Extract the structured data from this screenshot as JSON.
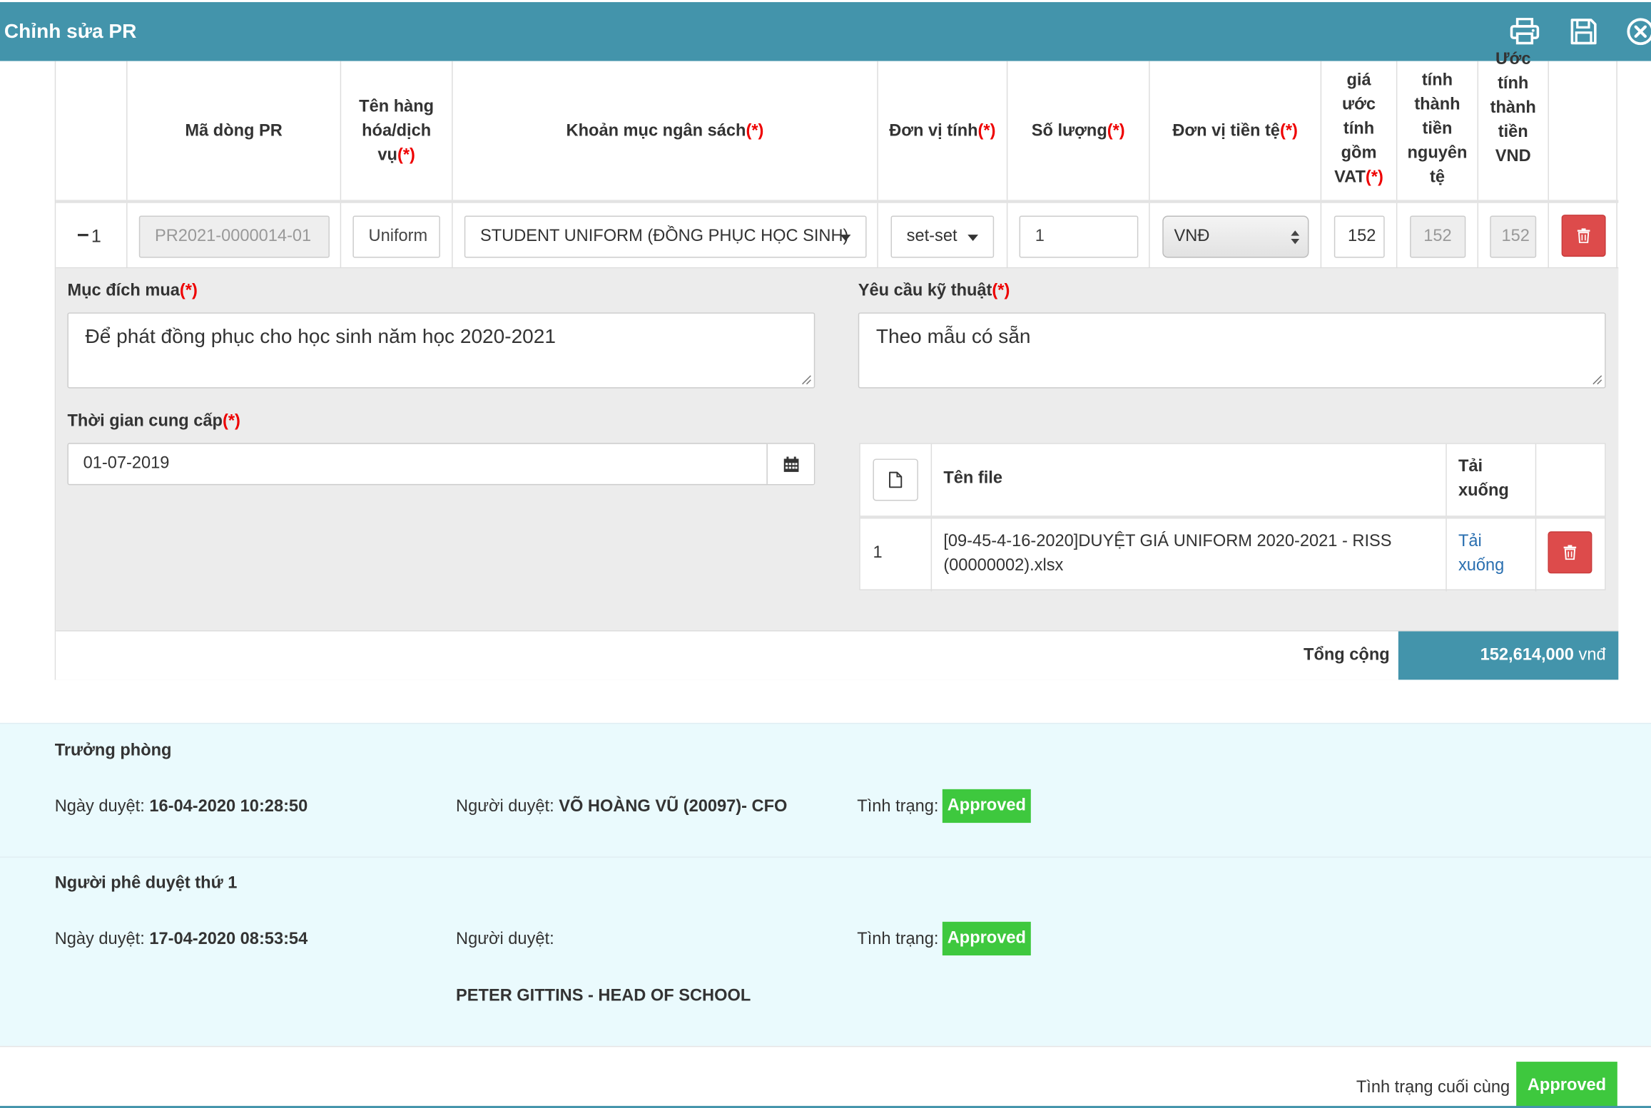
{
  "window": {
    "title": "Chỉnh sửa PR"
  },
  "icons": {
    "print": "print-icon",
    "save": "save-icon",
    "close": "close-circle-icon"
  },
  "columns": {
    "line_code": "Mã dòng PR",
    "item_name": "Tên hàng hóa/dịch vụ",
    "budget": "Khoản mục ngân sách",
    "unit": "Đơn vị tính",
    "quantity": "Số lượng",
    "currency": "Đơn vị tiền tệ",
    "est_price_vat": "giá ước tính gồm VAT",
    "est_total_orig": "tính thành tiền nguyên tệ",
    "est_total_vnd": "Ước tính thành tiền VND",
    "required_mark": "(*)"
  },
  "row": {
    "toggle": "−",
    "index": "1",
    "line_code": "PR2021-0000014-01",
    "item_name": "Uniform",
    "budget": "STUDENT UNIFORM (ĐỒNG PHỤC HỌC SINH)",
    "unit": "set-set",
    "quantity": "1",
    "currency": "VNĐ",
    "est_price_vat": "152",
    "est_total_orig": "152",
    "est_total_vnd": "152"
  },
  "detail": {
    "purpose_label": "Mục đích mua",
    "purpose_value": "Để phát đồng phục cho học sinh năm học 2020-2021",
    "tech_label": "Yêu cầu kỹ thuật",
    "tech_value": "Theo mẫu có sẵn",
    "supply_label": "Thời gian cung cấp",
    "supply_value": "01-07-2019"
  },
  "files": {
    "col_name": "Tên file",
    "col_download": "Tải xuống",
    "rows": [
      {
        "index": "1",
        "name": "[09-45-4-16-2020]DUYỆT GIÁ UNIFORM 2020-2021 - RISS (00000002).xlsx",
        "download": "Tải xuống"
      }
    ]
  },
  "total": {
    "label": "Tổng cộng",
    "value": "152,614,000",
    "unit": "vnđ"
  },
  "approvals": [
    {
      "title": "Trưởng phòng",
      "date_label": "Ngày duyệt:",
      "date_value": "16-04-2020 10:28:50",
      "approver_label": "Người duyệt:",
      "approver_value": "VÕ HOÀNG VŨ (20097)- CFO",
      "status_label": "Tình trạng:",
      "status_value": "Approved"
    },
    {
      "title": "Người phê duyệt thứ 1",
      "date_label": "Ngày duyệt:",
      "date_value": "17-04-2020 08:53:54",
      "approver_label": "Người duyệt:",
      "approver_value": "PETER GITTINS - HEAD OF SCHOOL",
      "status_label": "Tình trạng:",
      "status_value": "Approved"
    }
  ],
  "final_status": {
    "label": "Tình trạng cuối cùng",
    "value": "Approved"
  },
  "colors": {
    "header": "#4394ab",
    "approved": "#3ec83e",
    "danger": "#dd4b4b",
    "link": "#2a6fb0",
    "approval_bg": "#eafafd"
  }
}
